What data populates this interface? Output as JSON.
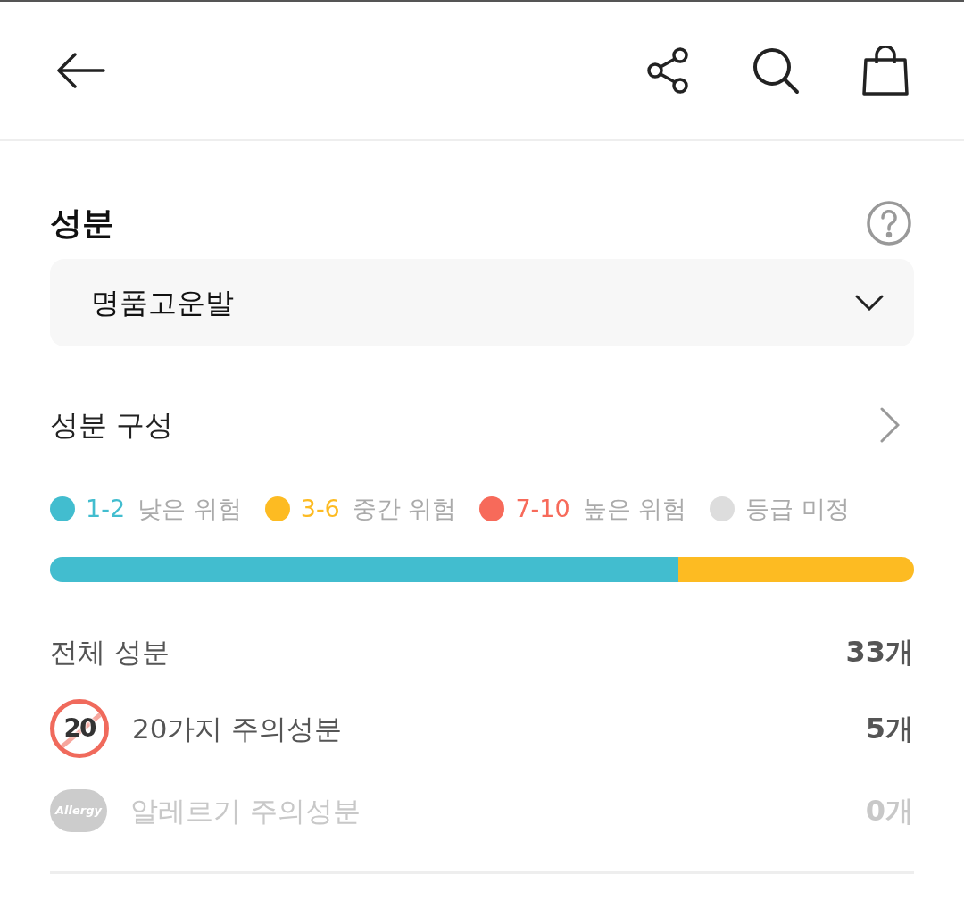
{
  "title": "성분",
  "product_select": {
    "value": "명품고운발"
  },
  "composition_link": {
    "label": "성분 구성"
  },
  "legend": [
    {
      "range": "1-2",
      "label": "낮은 위험",
      "color": "#42bdcf"
    },
    {
      "range": "3-6",
      "label": "중간 위험",
      "color": "#fdbb22"
    },
    {
      "range": "7-10",
      "label": "높은 위험",
      "color": "#f76a5a"
    },
    {
      "label": "등급 미정",
      "color": "#dddddd"
    }
  ],
  "bar": [
    {
      "color": "#42bdcf",
      "level": 0.727
    },
    {
      "color": "#fdbb22",
      "level": 0.273
    }
  ],
  "summary": [
    {
      "kind": "total",
      "label": "전체 성분",
      "count": "33개",
      "disabled": false
    },
    {
      "kind": "twenty",
      "icon_text": "20",
      "label": "20가지 주의성분",
      "count": "5개",
      "disabled": false
    },
    {
      "kind": "allergy",
      "icon_text": "Allergy",
      "label": "알레르기 주의성분",
      "count": "0개",
      "disabled": true
    }
  ]
}
